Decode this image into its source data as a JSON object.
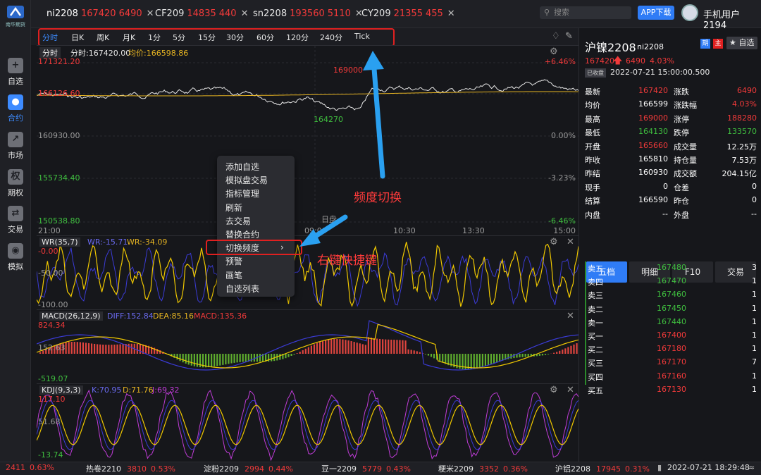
{
  "sidebar": {
    "items": [
      {
        "label": "自选",
        "icon": "plus-icon"
      },
      {
        "label": "合约",
        "icon": "person-icon",
        "active": true
      },
      {
        "label": "市场",
        "icon": "chart-icon"
      },
      {
        "label": "期权",
        "icon": "option-icon"
      },
      {
        "label": "交易",
        "icon": "trade-icon"
      },
      {
        "label": "模拟",
        "icon": "sim-icon"
      }
    ],
    "logo": "南华期货"
  },
  "tabs": [
    {
      "sym": "ni2208",
      "price": "167420",
      "chg": "6490"
    },
    {
      "sym": "CF209",
      "price": "14835",
      "chg": "440"
    },
    {
      "sym": "sn2208",
      "price": "193560",
      "chg": "5110"
    },
    {
      "sym": "CY209",
      "price": "21355",
      "chg": "455"
    }
  ],
  "search": {
    "placeholder": "搜索"
  },
  "app_download": "APP下载",
  "user": "手机用户2194",
  "freq": [
    "分时",
    "日K",
    "周K",
    "月K",
    "1分",
    "5分",
    "15分",
    "30分",
    "60分",
    "120分",
    "240分",
    "Tick"
  ],
  "chart": {
    "label_mode": "分时",
    "cur_price": "分时:167420.00",
    "avg_price": "均价:166598.86",
    "y_labels": [
      "171321.20",
      "166126.60",
      "160930.00",
      "155734.40",
      "150538.80"
    ],
    "pct_labels": [
      "+6.46%",
      "0.00%",
      "-3.23%",
      "-6.46%"
    ],
    "x_labels": [
      "21:00",
      "09:00",
      "10:30",
      "13:30",
      "15:00"
    ],
    "high_mark": "169000",
    "low_mark": "164270",
    "session_labels": [
      "日盘"
    ]
  },
  "context_menu": [
    "添加自选",
    "模拟盘交易",
    "指标管理",
    "刷新",
    "去交易",
    "替换合约",
    "切换频度",
    "预警",
    "画笔",
    "自选列表"
  ],
  "annotations": {
    "freq_switch": "频度切换",
    "right_click": "右键快捷键"
  },
  "wr": {
    "name": "WR(35,7)",
    "wr": "WR:-15.71",
    "wr2": "WR:-34.09",
    "y": [
      "-0.00",
      "-50.00",
      "-100.00"
    ]
  },
  "macd": {
    "name": "MACD(26,12,9)",
    "diff": "DIFF:152.84",
    "dea": "DEA:85.16",
    "macd": "MACD:135.36",
    "y": [
      "824.34",
      "152.63",
      "-519.07"
    ]
  },
  "kdj": {
    "name": "KDJ(9,3,3)",
    "k": "K:70.95",
    "d": "D:71.76",
    "j": "J:69.32",
    "y": [
      "117.10",
      "51.68",
      "-13.74"
    ]
  },
  "quote": {
    "name": "沪镍2208",
    "code": "ni2208",
    "price": "167420",
    "chg": "6490",
    "pct": "4.03%",
    "status": "已收盘",
    "time": "2022-07-21 15:00:00.500",
    "tag_a": "期",
    "tag_b": "主",
    "fav": "自选",
    "left": [
      [
        "最新",
        "167420",
        "red"
      ],
      [
        "均价",
        "166599",
        "white"
      ],
      [
        "最高",
        "169000",
        "red"
      ],
      [
        "最低",
        "164130",
        "green"
      ],
      [
        "开盘",
        "165660",
        "red"
      ],
      [
        "昨收",
        "165810",
        "white"
      ],
      [
        "昨结",
        "160930",
        "white"
      ],
      [
        "现手",
        "0",
        "white"
      ],
      [
        "结算",
        "166590",
        "white"
      ],
      [
        "内盘",
        "--",
        "white"
      ]
    ],
    "right": [
      [
        "涨跌",
        "6490",
        "red"
      ],
      [
        "涨跌幅",
        "4.03%",
        "red"
      ],
      [
        "涨停",
        "188280",
        "red"
      ],
      [
        "跌停",
        "133570",
        "green"
      ],
      [
        "成交量",
        "12.25万",
        "white"
      ],
      [
        "持仓量",
        "7.53万",
        "white"
      ],
      [
        "成交额",
        "204.15亿",
        "white"
      ],
      [
        "仓差",
        "0",
        "white"
      ],
      [
        "昨仓",
        "0",
        "white"
      ],
      [
        "外盘",
        "--",
        "white"
      ]
    ],
    "tabs": [
      "五档",
      "明细",
      "F10",
      "交易"
    ],
    "book": [
      [
        "卖五",
        "167480",
        "3"
      ],
      [
        "卖四",
        "167470",
        "1"
      ],
      [
        "卖三",
        "167460",
        "1"
      ],
      [
        "卖二",
        "167450",
        "1"
      ],
      [
        "卖一",
        "167440",
        "1"
      ],
      [
        "买一",
        "167400",
        "1"
      ],
      [
        "买二",
        "167180",
        "1"
      ],
      [
        "买三",
        "167170",
        "7"
      ],
      [
        "买四",
        "167160",
        "1"
      ],
      [
        "买五",
        "167130",
        "1"
      ]
    ]
  },
  "ticker": [
    {
      "name": "",
      "v": "2411",
      "p": "0.63%"
    },
    {
      "name": "热卷2210",
      "v": "3810",
      "p": "0.53%"
    },
    {
      "name": "淀粉2209",
      "v": "2994",
      "p": "0.44%"
    },
    {
      "name": "豆一2209",
      "v": "5779",
      "p": "0.43%"
    },
    {
      "name": "粳米2209",
      "v": "3352",
      "p": "0.36%"
    },
    {
      "name": "沪铝2208",
      "v": "17945",
      "p": "0.31%"
    }
  ],
  "clock": "2022-07-21 18:29:48"
}
